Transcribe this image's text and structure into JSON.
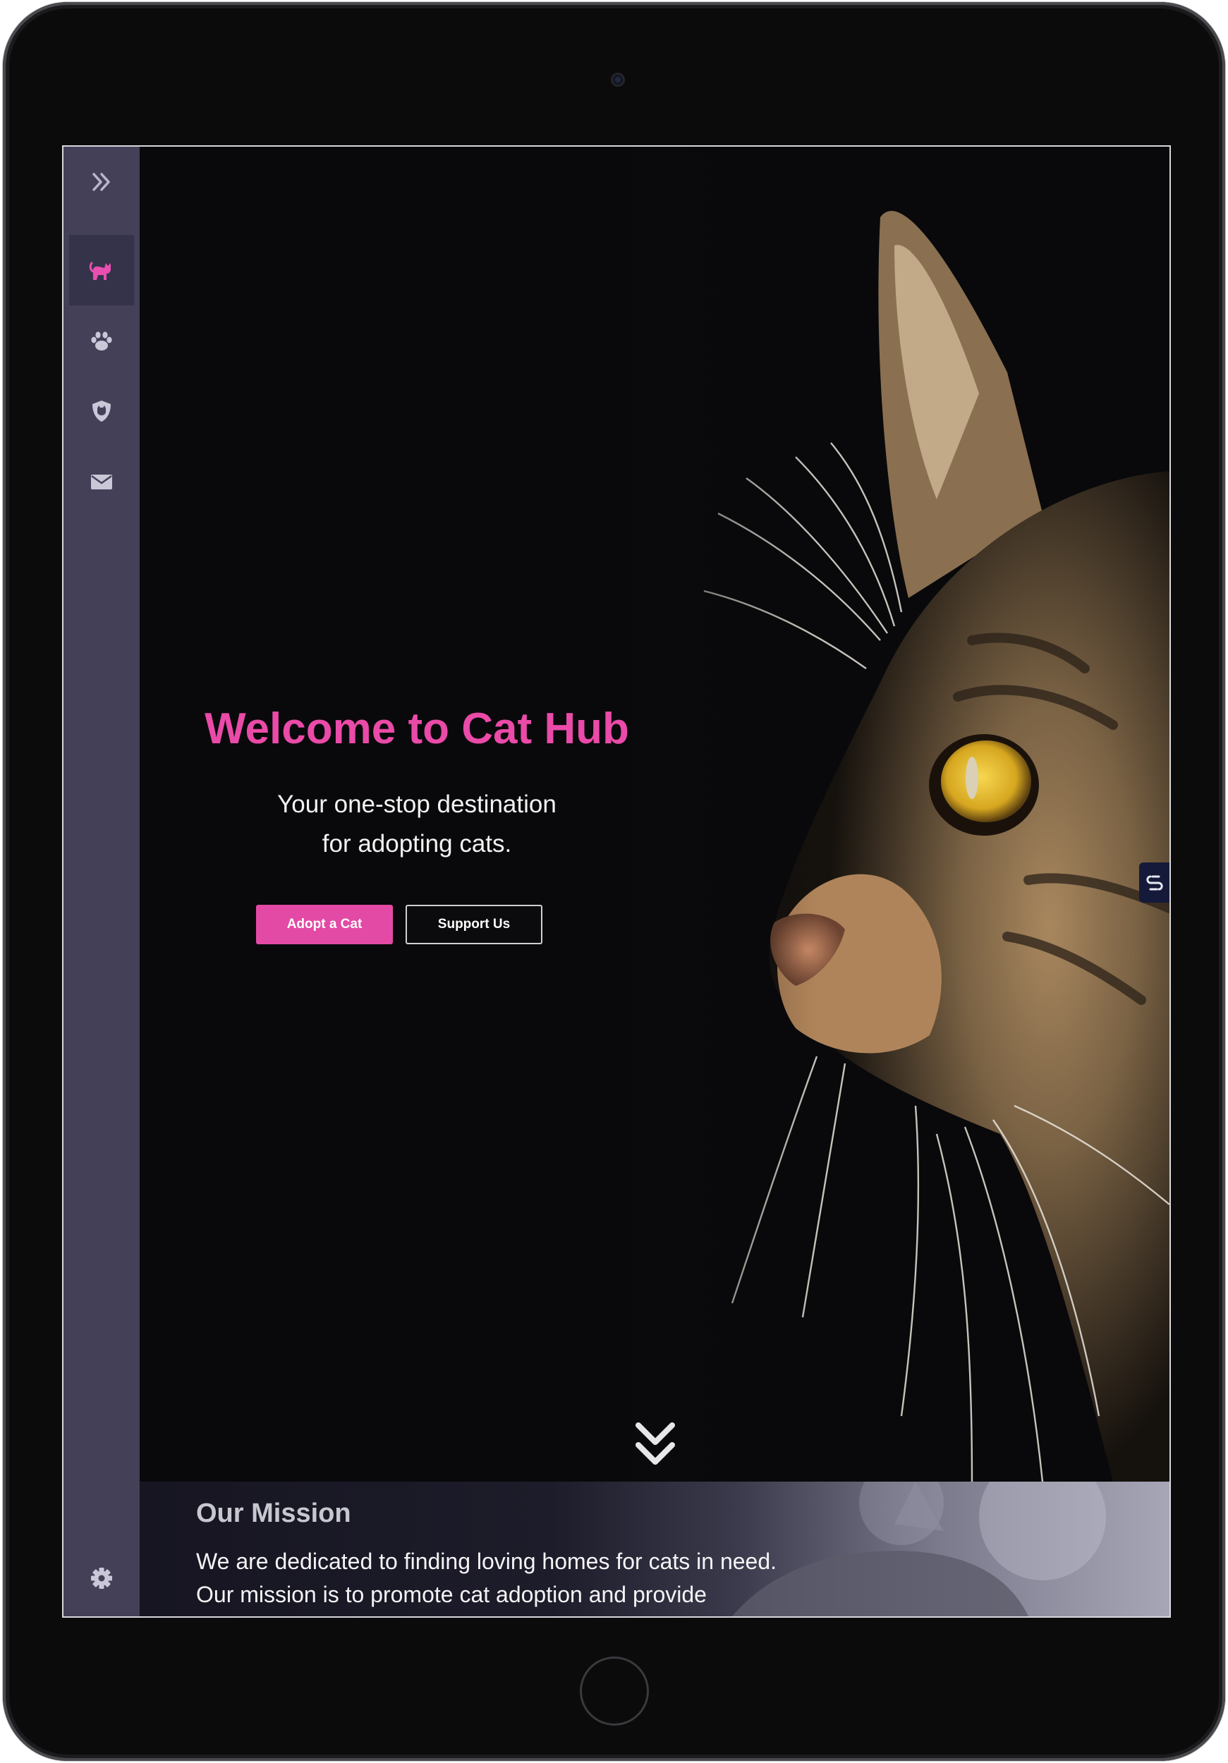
{
  "sidebar": {
    "expand_icon": "chevrons-right-icon",
    "items": [
      {
        "icon": "cat-icon",
        "active": true
      },
      {
        "icon": "paw-icon",
        "active": false
      },
      {
        "icon": "shield-cat-icon",
        "active": false
      },
      {
        "icon": "envelope-icon",
        "active": false
      }
    ],
    "settings_icon": "gear-icon"
  },
  "hero": {
    "title": "Welcome to Cat Hub",
    "tagline_line1": "Your one-stop destination",
    "tagline_line2": "for adopting cats.",
    "primary_button": "Adopt a Cat",
    "secondary_button": "Support Us",
    "scroll_icon": "chevrons-down-icon",
    "image": "tabby-cat-profile-photo"
  },
  "mission": {
    "title": "Our Mission",
    "line1": "We are dedicated to finding loving homes for cats in need.",
    "line2": "Our mission is to promote cat adoption and provide"
  },
  "colors": {
    "accent": "#e34aa5",
    "sidebar": "#434058",
    "background": "#0b0b0e"
  }
}
